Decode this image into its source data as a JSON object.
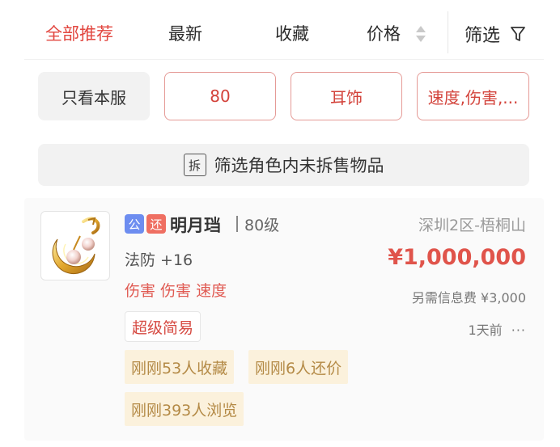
{
  "sort_bar": {
    "items": [
      "全部推荐",
      "最新",
      "收藏",
      "价格"
    ],
    "filter_label": "筛选",
    "active_color": "#e2463f"
  },
  "filters": {
    "chips": [
      "只看本服",
      "80",
      "耳饰",
      "速度,伤害,..."
    ],
    "unsplit_box": "拆",
    "unsplit_label": "筛选角色内未拆售物品"
  },
  "listing": {
    "badge_official": "公",
    "badge_bargain": "还",
    "seller_name": "明月珰",
    "level": "80级",
    "attribute": "法防 +16",
    "special_tags": "伤害 伤害 速度",
    "difficulty_tag": "超级简易",
    "stats": [
      "刚刚53人收藏",
      "刚刚6人还价",
      "刚刚393人浏览"
    ],
    "server": "深圳2区-梧桐山",
    "price": "¥1,000,000",
    "fee": "另需信息费 ¥3,000",
    "time": "1天前",
    "more_icon": "ellipsis-icon",
    "price_color": "#e0544b"
  }
}
